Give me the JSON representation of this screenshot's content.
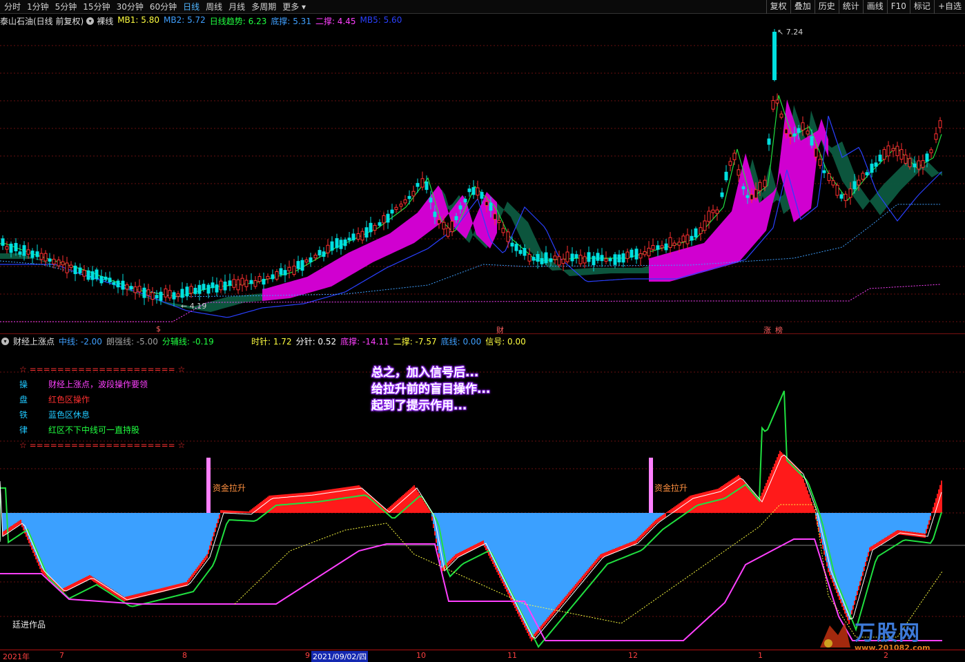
{
  "toolbar": {
    "tabs": [
      "分时",
      "1分钟",
      "5分钟",
      "15分钟",
      "30分钟",
      "60分钟",
      "日线",
      "周线",
      "月线",
      "多周期",
      "更多"
    ],
    "active_tab": "日线",
    "tools": [
      "复权",
      "叠加",
      "历史",
      "统计",
      "画线",
      "F10",
      "标记",
      "+自选"
    ]
  },
  "main_chart": {
    "title": "泰山石油(日线 前复权)",
    "mode": "裸线",
    "indicators": [
      {
        "label": "MB1:",
        "value": "5.80",
        "color": "#ffff40"
      },
      {
        "label": "MB2:",
        "value": "5.72",
        "color": "#3fa0ff"
      },
      {
        "label": "日线趋势:",
        "value": "6.23",
        "color": "#20ff40"
      },
      {
        "label": "底撑:",
        "value": "5.31",
        "color": "#40a0ff"
      },
      {
        "label": "二撑:",
        "value": "4.45",
        "color": "#ff40ff"
      },
      {
        "label": "MB5:",
        "value": "5.60",
        "color": "#2a40ff"
      }
    ],
    "high_label": "7.24",
    "low_label": "4.19",
    "markers": [
      "$",
      "财",
      "涨",
      "榜"
    ]
  },
  "sub_chart": {
    "title": "财经上涨点",
    "indicators_left": [
      {
        "label": "中线:",
        "value": "-2.00",
        "color": "#3fa0ff"
      },
      {
        "label": "朗强线:",
        "value": "-5.00",
        "color": "#a0a0a0"
      },
      {
        "label": "分辅线:",
        "value": "-0.19",
        "color": "#20ff40"
      }
    ],
    "indicators_right": [
      {
        "label": "时针:",
        "value": "1.72",
        "color": "#ffff40"
      },
      {
        "label": "分针:",
        "value": "0.52",
        "color": "#ffffff"
      },
      {
        "label": "底撑:",
        "value": "-14.11",
        "color": "#ff40ff"
      },
      {
        "label": "二撑:",
        "value": "-7.57",
        "color": "#ffff40"
      },
      {
        "label": "底线:",
        "value": "0.00",
        "color": "#3fa0ff"
      },
      {
        "label": "信号:",
        "value": "0.00",
        "color": "#ffff40"
      }
    ],
    "legend_sep": "☆ ===================== ☆",
    "legend": [
      {
        "k": "操",
        "v": "财经上涨点，波段操作要领",
        "color": "#ff40ff"
      },
      {
        "k": "盘",
        "v": "红色区操作",
        "color": "#ff3030"
      },
      {
        "k": "铁",
        "v": "蓝色区休息",
        "color": "#20c8ff"
      },
      {
        "k": "律",
        "v": "红区不下中线可一直持股",
        "color": "#20ff40"
      }
    ],
    "signal_label": "资金拉升",
    "note": [
      "总之，加入信号后...",
      "给拉升前的盲目操作...",
      "起到了提示作用..."
    ],
    "author": "廷进作品"
  },
  "xaxis": {
    "labels": [
      "2021年",
      "7",
      "8",
      "9",
      "2021/09/02/四",
      "10",
      "11",
      "12",
      "1",
      "2"
    ]
  },
  "watermark": {
    "title": "万股网",
    "url": "www.201082.com"
  },
  "colors": {
    "up": "#ff3030",
    "down": "#00e0e0",
    "ribbon_up": "#ff00ff",
    "ribbon_down": "#0a6a4a"
  }
}
